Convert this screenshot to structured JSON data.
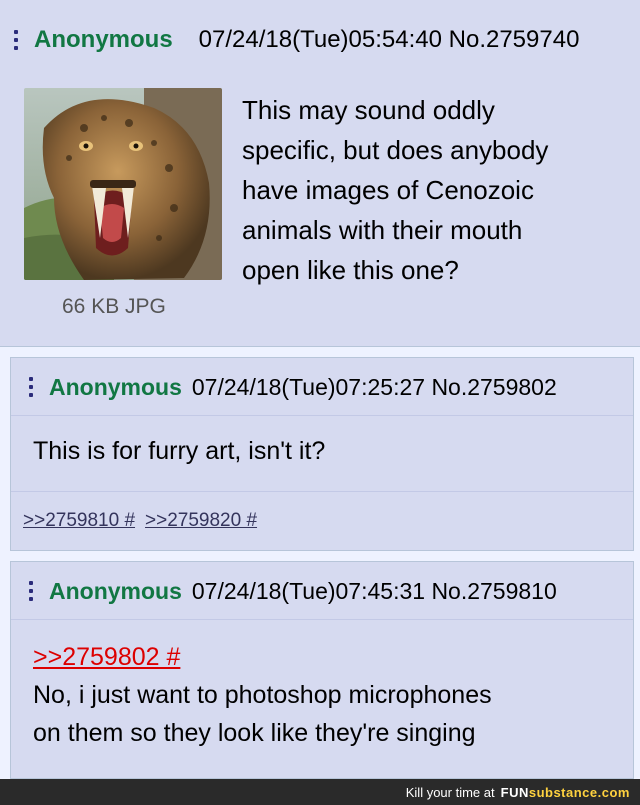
{
  "op": {
    "name": "Anonymous",
    "datetime": "07/24/18(Tue)05:54:40",
    "post_no": "No.2759740",
    "image_info": "66 KB JPG",
    "text_lines": [
      "This may sound oddly",
      "specific, but does anybody",
      "have images of Cenozoic",
      "animals with their mouth",
      "open like this one?"
    ]
  },
  "reply1": {
    "name": "Anonymous",
    "datetime": "07/24/18(Tue)07:25:27",
    "post_no": "No.2759802",
    "text": "This is for furry art, isn't it?",
    "backlinks": [
      ">>2759810 #",
      ">>2759820 #"
    ]
  },
  "reply2": {
    "name": "Anonymous",
    "datetime": "07/24/18(Tue)07:45:31",
    "post_no": "No.2759810",
    "quote_link": ">>2759802 #",
    "text_lines": [
      "No, i just want to photoshop microphones",
      "on them so they look like they're singing"
    ]
  },
  "footer": {
    "caption": "Kill your time at",
    "brand_prefix": "FUN",
    "brand_suffix": "substance.com"
  }
}
